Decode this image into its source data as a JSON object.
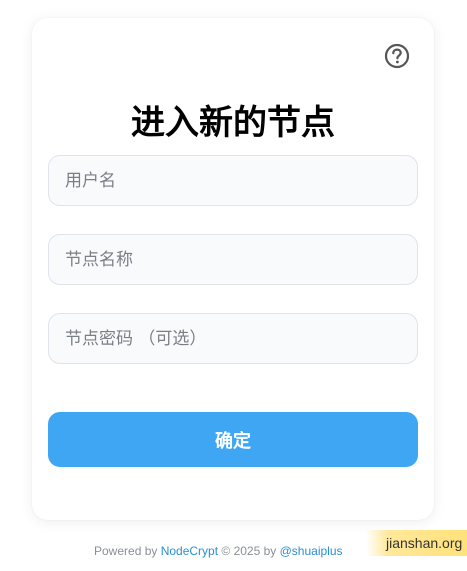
{
  "card": {
    "title": "进入新的节点",
    "fields": {
      "username_placeholder": "用户名",
      "node_name_placeholder": "节点名称",
      "node_password_placeholder": "节点密码 （可选）"
    },
    "confirm_label": "确定"
  },
  "icons": {
    "help": "question-circle-icon"
  },
  "footer": {
    "prefix": "Powered by ",
    "project_link": "NodeCrypt",
    "middle": " © 2025 by ",
    "author_link": "@shuaiplus"
  },
  "watermark": {
    "text": "jianshan.org"
  },
  "colors": {
    "accent": "#3fa6f4",
    "link": "#2b8fd6"
  }
}
